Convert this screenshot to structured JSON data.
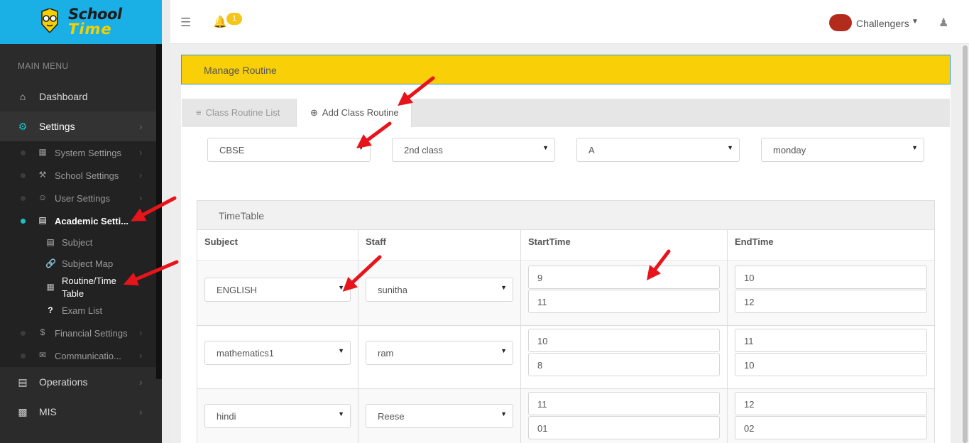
{
  "brand": {
    "line1": "School",
    "line2": "Time"
  },
  "sidebar": {
    "menu_header": "MAIN MENU",
    "items": [
      {
        "label": "Dashboard",
        "icon": "home-icon"
      },
      {
        "label": "Settings",
        "icon": "gear-icon"
      },
      {
        "label": "Operations",
        "icon": "document-icon"
      },
      {
        "label": "MIS",
        "icon": "bar-chart-icon"
      }
    ],
    "settings_sub": [
      {
        "label": "System Settings",
        "icon": "building-icon"
      },
      {
        "label": "School Settings",
        "icon": "wrench-icon"
      },
      {
        "label": "User Settings",
        "icon": "user-icon"
      },
      {
        "label": "Academic Setti...",
        "icon": "book-icon"
      },
      {
        "label": "Financial Settings",
        "icon": "dollar-icon"
      },
      {
        "label": "Communicatio...",
        "icon": "envelope-icon"
      }
    ],
    "academic_sub": [
      {
        "label": "Subject",
        "icon": "book-icon"
      },
      {
        "label": "Subject Map",
        "icon": "link-icon"
      },
      {
        "label": "Routine/Time Table",
        "line1": "Routine/Time",
        "line2": "Table",
        "icon": "table-icon"
      },
      {
        "label": "Exam List",
        "icon": "question-icon"
      }
    ]
  },
  "header": {
    "notification_count": "1",
    "user_name": "Challengers"
  },
  "panel": {
    "title": "Manage Routine",
    "tabs": [
      {
        "label": "Class Routine List",
        "icon": "list-icon"
      },
      {
        "label": "Add Class Routine",
        "icon": "plus-circle-icon"
      }
    ],
    "filters": {
      "board": "CBSE",
      "class": "2nd class",
      "section": "A",
      "day": "monday"
    }
  },
  "timetable": {
    "title": "TimeTable",
    "columns": [
      "Subject",
      "Staff",
      "StartTime",
      "EndTime"
    ],
    "rows": [
      {
        "subject": "ENGLISH",
        "staff": "sunitha",
        "start": [
          "9",
          "11"
        ],
        "end": [
          "10",
          "12"
        ]
      },
      {
        "subject": "mathematics1",
        "staff": "ram",
        "start": [
          "10",
          "8"
        ],
        "end": [
          "11",
          "10"
        ]
      },
      {
        "subject": "hindi",
        "staff": "Reese",
        "start": [
          "11",
          "01"
        ],
        "end": [
          "12",
          "02"
        ]
      }
    ]
  },
  "colors": {
    "accent": "#f9cf07",
    "brand_blue": "#1ab0e6",
    "sidebar": "#2b2b2b",
    "arrow": "#e8141b"
  }
}
